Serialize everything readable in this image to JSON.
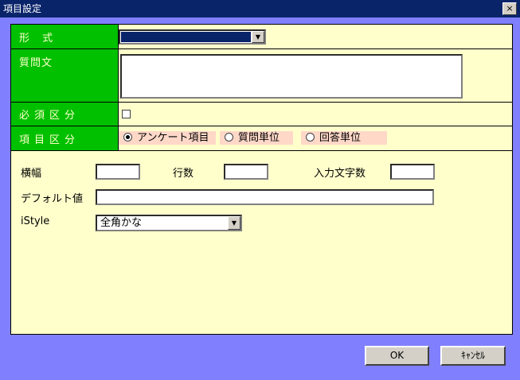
{
  "window": {
    "title": "項目設定",
    "close_glyph": "×"
  },
  "rows": {
    "format_label": "形 式",
    "question_label": "質問文",
    "required_label": "必須区分",
    "item_type_label": "項目区分",
    "item_type_options": [
      "アンケート項目",
      "質問単位",
      "回答単位"
    ],
    "item_type_selected": "アンケート項目"
  },
  "fields": {
    "width_label": "横幅",
    "lines_label": "行数",
    "maxchars_label": "入力文字数",
    "default_label": "デフォルト値",
    "istyle_label": "iStyle",
    "istyle_value": "全角かな"
  },
  "buttons": {
    "ok": "OK",
    "cancel": "ｷｬﾝｾﾙ"
  },
  "icons": {
    "dropdown": "▼"
  }
}
